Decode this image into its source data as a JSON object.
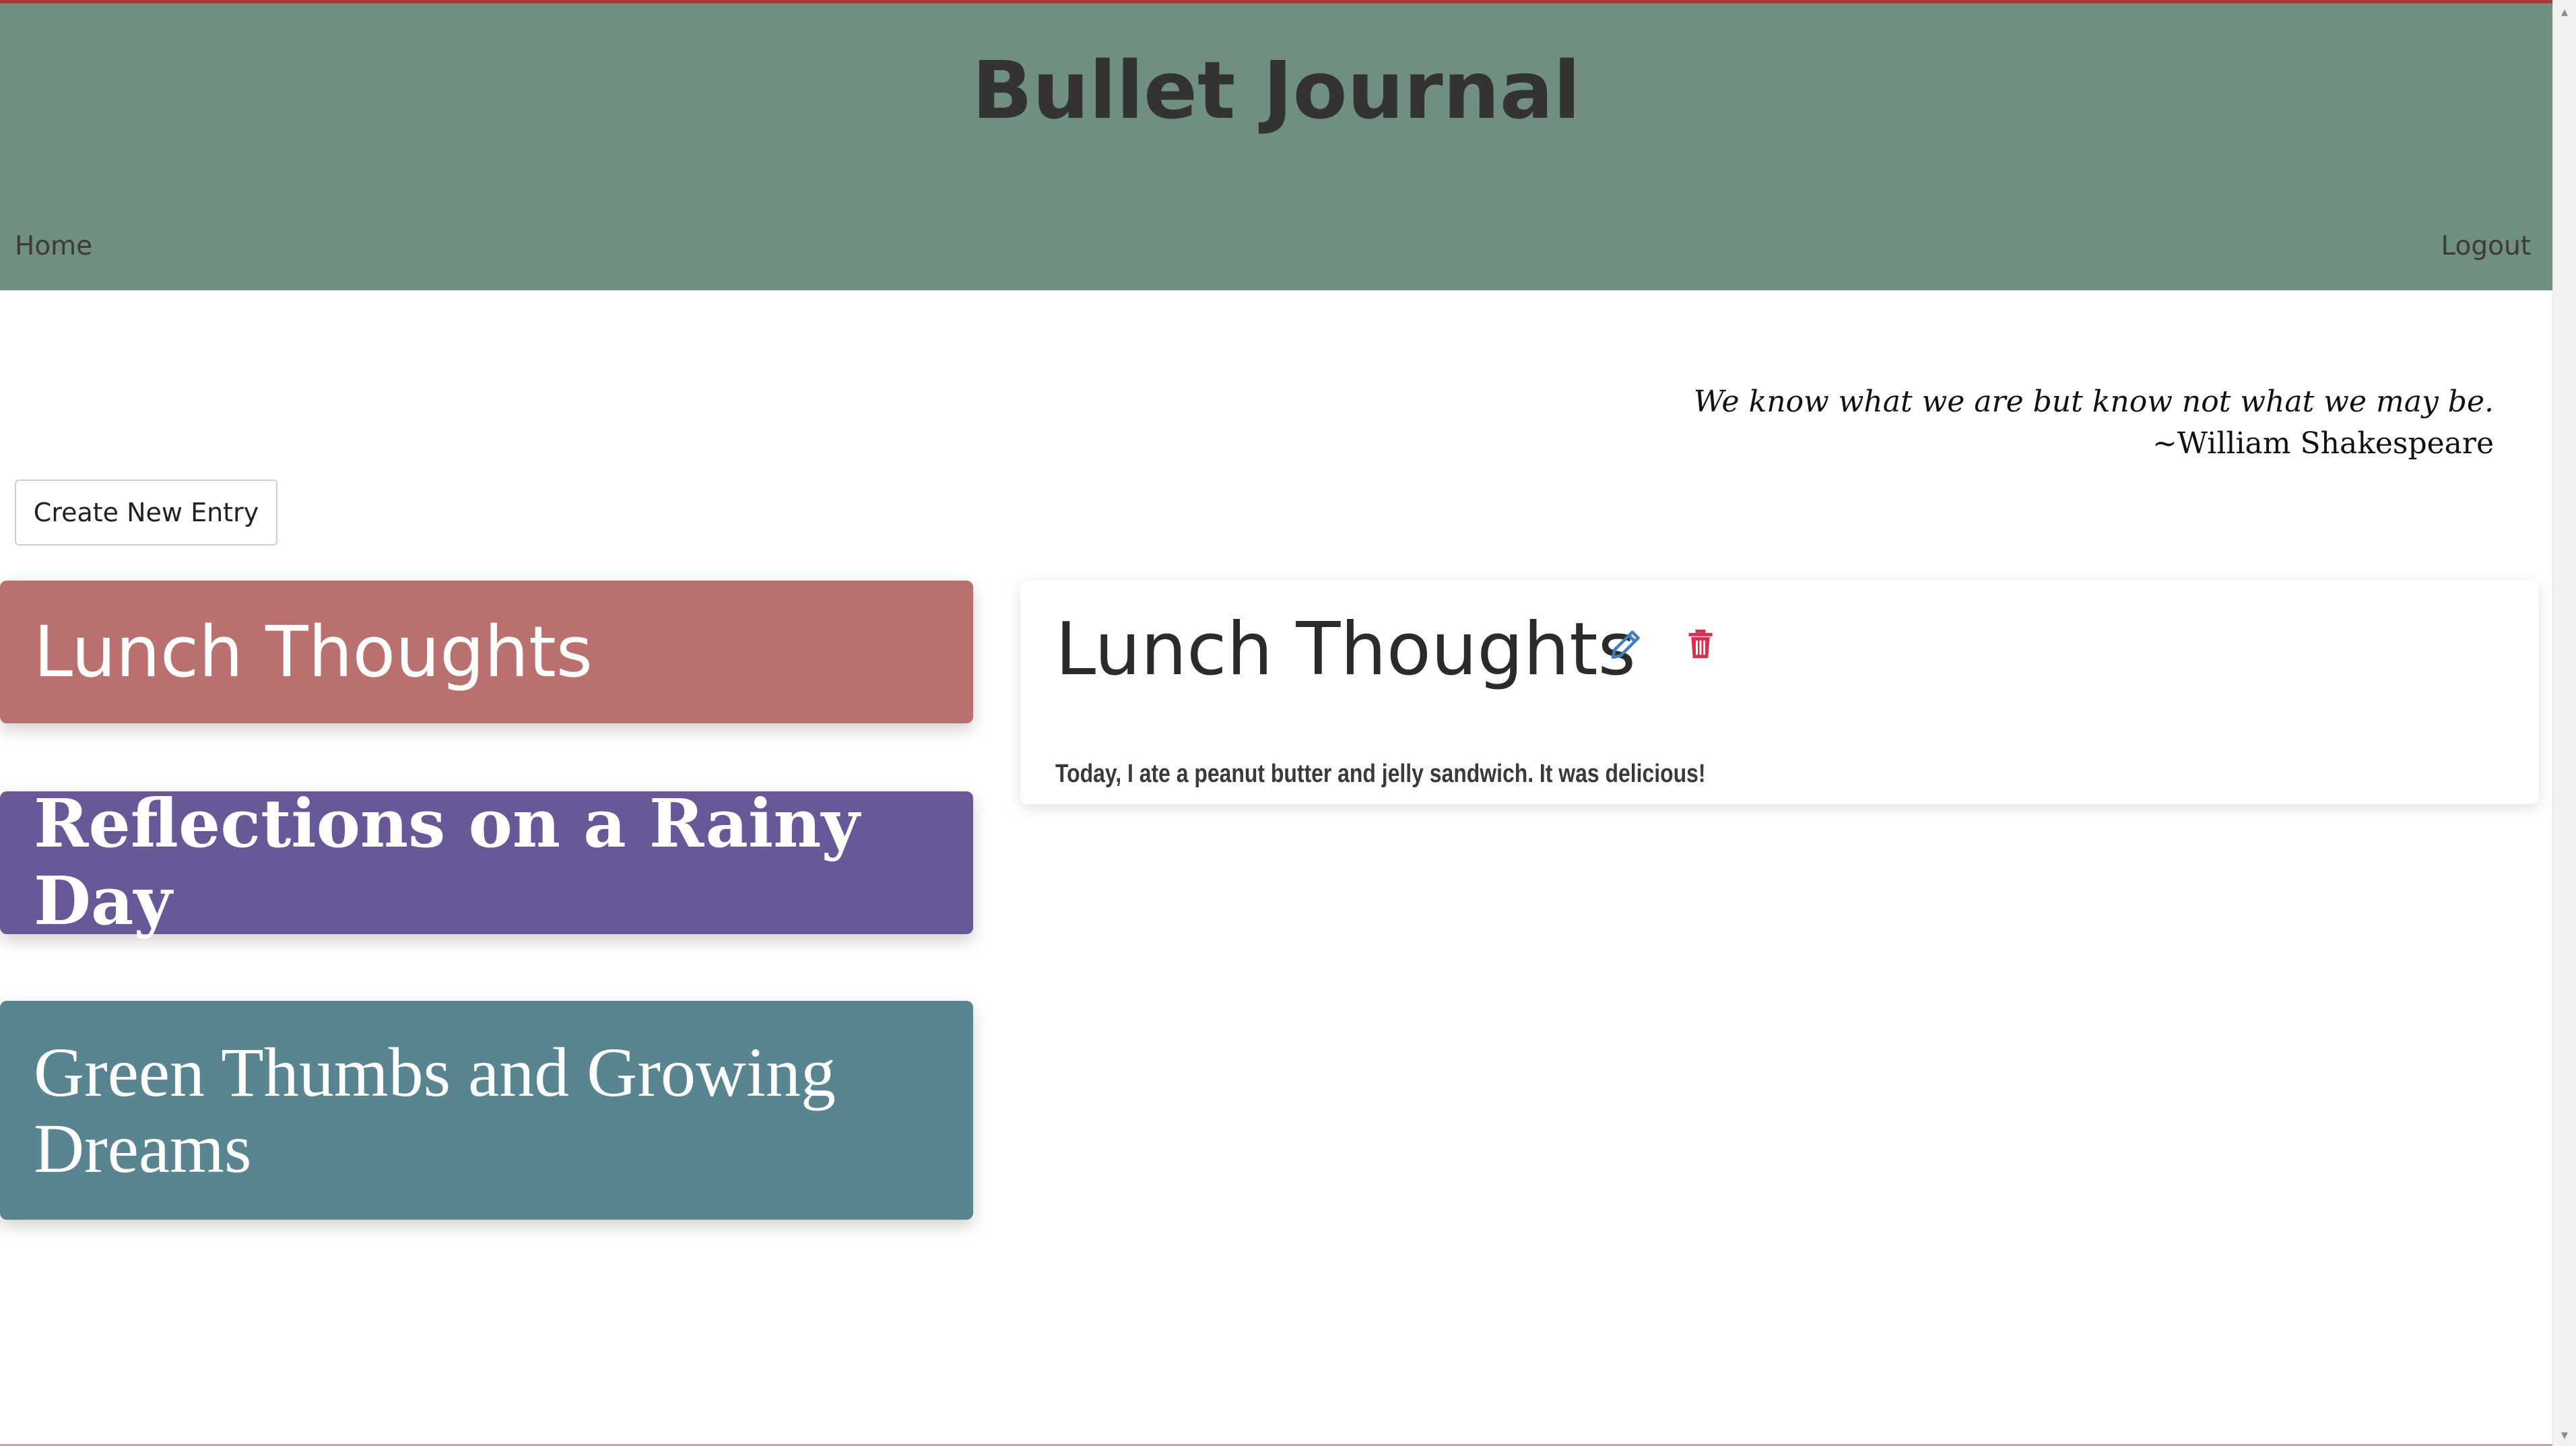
{
  "app": {
    "title": "Bullet Journal"
  },
  "nav": {
    "home": "Home",
    "logout": "Logout"
  },
  "quote": {
    "text": "We know what we are but know not what we may be.",
    "author": "~William Shakespeare"
  },
  "actions": {
    "create_label": "Create New Entry"
  },
  "entries": [
    {
      "title": "Lunch Thoughts",
      "color": "#bb7070"
    },
    {
      "title": "Reflections on a Rainy Day",
      "color": "#695897"
    },
    {
      "title": "Green Thumbs and Growing Dreams",
      "color": "#58858f"
    }
  ],
  "selected_entry": {
    "title": "Lunch Thoughts",
    "body": "Today, I ate a peanut butter and jelly sandwich. It was delicious!",
    "edit_icon": "pencil-icon",
    "delete_icon": "trash-icon",
    "edit_color": "#3f7fbf",
    "delete_color": "#d63050"
  },
  "theme": {
    "header_bg": "#718f80",
    "top_border": "#a83c3c"
  }
}
